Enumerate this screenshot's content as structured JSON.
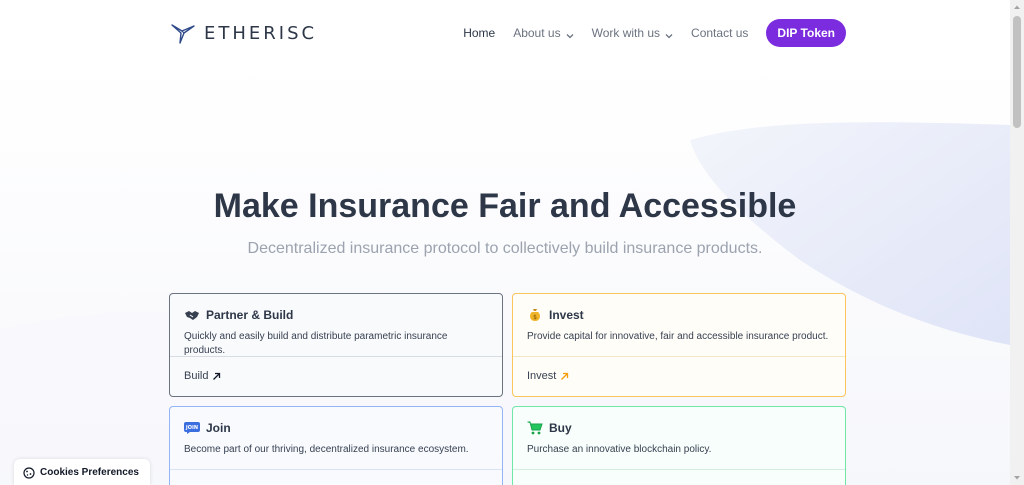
{
  "brand": {
    "name": "ETHERISC",
    "logo_icon": "bird-logo-icon",
    "accent_color": "#7b2cde"
  },
  "nav": {
    "home": "Home",
    "about": "About us",
    "work": "Work with us",
    "contact": "Contact us",
    "cta": "DIP Token"
  },
  "hero": {
    "title": "Make Insurance Fair and Accessible",
    "subtitle": "Decentralized insurance protocol to collectively build insurance products."
  },
  "cards": [
    {
      "title": "Partner & Build",
      "description": "Quickly and easily build and distribute parametric insurance products.",
      "link": "Build",
      "icon": "handshake-icon",
      "border_color": "#6b7280"
    },
    {
      "title": "Invest",
      "description": "Provide capital for innovative, fair and accessible insurance product.",
      "link": "Invest",
      "icon": "money-bag-icon",
      "border_color": "#fbc55e"
    },
    {
      "title": "Join",
      "description": "Become part of our thriving, decentralized insurance ecosystem.",
      "link": "",
      "icon": "join-badge-icon",
      "icon_text": "JOIN",
      "border_color": "#93b4f5"
    },
    {
      "title": "Buy",
      "description": "Purchase an innovative blockchain policy.",
      "link": "",
      "icon": "shopping-cart-icon",
      "border_color": "#6ee7a7"
    }
  ],
  "cookies": {
    "label": "Cookies Preferences",
    "icon": "cookie-icon"
  }
}
